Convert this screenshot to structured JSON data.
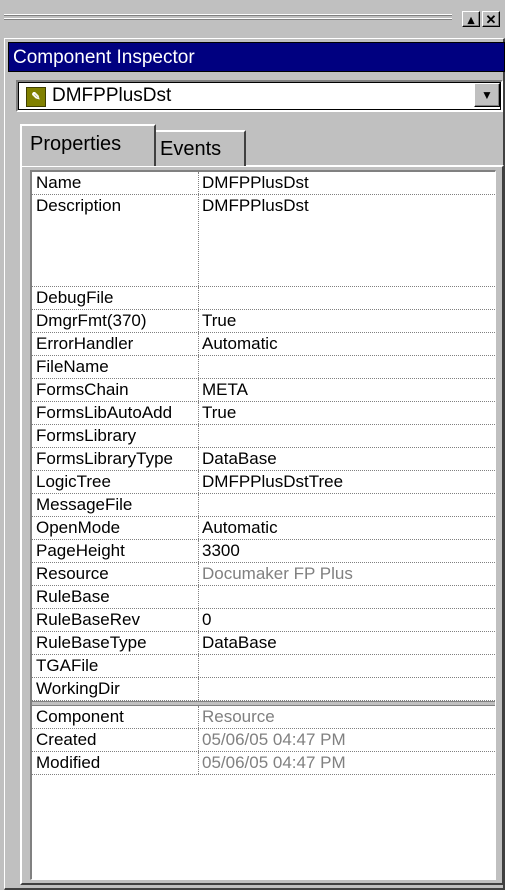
{
  "window": {
    "minimize_glyph": "▴",
    "close_glyph": "✕"
  },
  "inspector": {
    "title": "Component Inspector",
    "component_select": {
      "icon": "component-icon",
      "value": "DMFPPlusDst"
    },
    "tabs": [
      {
        "label": "Properties",
        "active": true
      },
      {
        "label": "Events",
        "active": false
      }
    ],
    "properties": [
      {
        "name": "Name",
        "value": "DMFPPlusDst"
      },
      {
        "name": "Description",
        "value": "DMFPPlusDst"
      },
      {
        "name": "DebugFile",
        "value": ""
      },
      {
        "name": "DmgrFmt(370)",
        "value": "True"
      },
      {
        "name": "ErrorHandler",
        "value": "Automatic"
      },
      {
        "name": "FileName",
        "value": ""
      },
      {
        "name": "FormsChain",
        "value": "META"
      },
      {
        "name": "FormsLibAutoAdd",
        "value": "True"
      },
      {
        "name": "FormsLibrary",
        "value": ""
      },
      {
        "name": "FormsLibraryType",
        "value": "DataBase"
      },
      {
        "name": "LogicTree",
        "value": "DMFPPlusDstTree"
      },
      {
        "name": "MessageFile",
        "value": ""
      },
      {
        "name": "OpenMode",
        "value": "Automatic"
      },
      {
        "name": "PageHeight",
        "value": "3300"
      },
      {
        "name": "Resource",
        "value": "Documaker FP Plus"
      },
      {
        "name": "RuleBase",
        "value": ""
      },
      {
        "name": "RuleBaseRev",
        "value": "0"
      },
      {
        "name": "RuleBaseType",
        "value": "DataBase"
      },
      {
        "name": "TGAFile",
        "value": ""
      },
      {
        "name": "WorkingDir",
        "value": ""
      }
    ],
    "readonly": [
      {
        "name": "Component",
        "value": "Resource"
      },
      {
        "name": "Created",
        "value": "05/06/05 04:47 PM"
      },
      {
        "name": "Modified",
        "value": "05/06/05 04:47 PM"
      }
    ]
  }
}
